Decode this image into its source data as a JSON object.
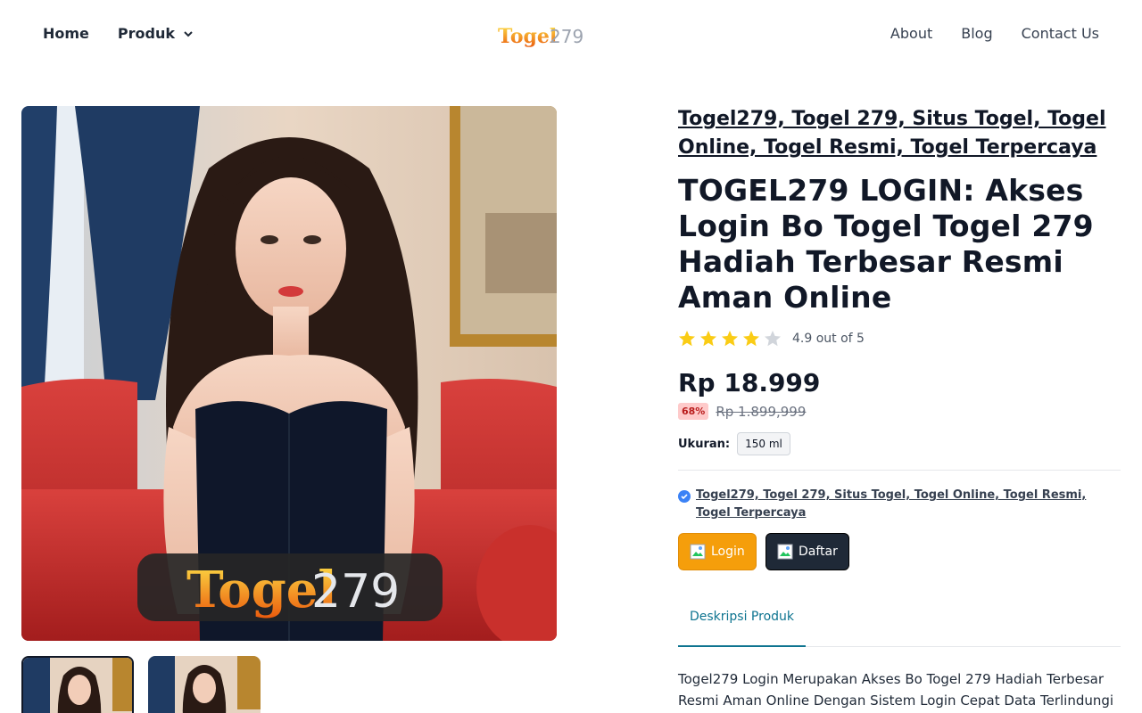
{
  "nav": {
    "home": "Home",
    "produk": "Produk",
    "about": "About",
    "blog": "Blog",
    "contact": "Contact Us"
  },
  "logo": {
    "main": "Togel",
    "num": "279",
    "banner_main": "Togel",
    "banner_num": "279"
  },
  "product": {
    "category_link": "Togel279, Togel 279, Situs Togel, Togel Online, Togel Resmi, Togel Terpercaya",
    "title": "TOGEL279 LOGIN: Akses Login Bo Togel Togel 279 Hadiah Terbesar Resmi Aman Online",
    "rating_value": 4.9,
    "rating_text": "4.9 out of 5",
    "price": "Rp 18.999",
    "discount_badge": "68%",
    "old_price": "Rp 1.899,999",
    "size_label": "Ukuran:",
    "size_value": "150 ml",
    "seller_link": "Togel279, Togel 279, Situs Togel, Togel Online, Togel Resmi, Togel Terpercaya",
    "login_label": "Login",
    "daftar_label": "Daftar",
    "tab_label": "Deskripsi Produk",
    "description": "Togel279 Login Merupakan Akses Bo Togel 279 Hadiah Terbesar Resmi Aman Online Dengan Sistem Login Cepat Data Terlindungi"
  },
  "colors": {
    "accent_orange": "#f59e0b",
    "dark_button": "#1f2937",
    "star_yellow": "#facc15",
    "tab_teal": "#0e7490",
    "badge_red": "#fecaca"
  }
}
